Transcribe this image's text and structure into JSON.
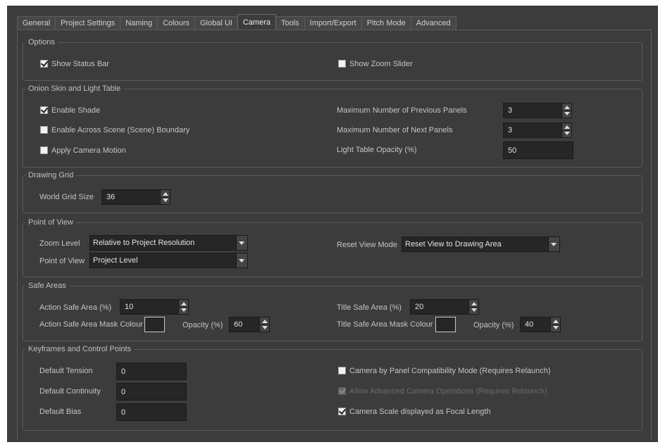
{
  "tabs": [
    {
      "label": "General",
      "active": false
    },
    {
      "label": "Project Settings",
      "active": false
    },
    {
      "label": "Naming",
      "active": false
    },
    {
      "label": "Colours",
      "active": false
    },
    {
      "label": "Global UI",
      "active": false
    },
    {
      "label": "Camera",
      "active": true
    },
    {
      "label": "Tools",
      "active": false
    },
    {
      "label": "Import/Export",
      "active": false
    },
    {
      "label": "Pitch Mode",
      "active": false
    },
    {
      "label": "Advanced",
      "active": false
    }
  ],
  "options": {
    "title": "Options",
    "show_status_bar": {
      "label": "Show Status Bar",
      "checked": true
    },
    "show_zoom_slider": {
      "label": "Show Zoom Slider",
      "checked": false
    }
  },
  "onion": {
    "title": "Onion Skin and Light Table",
    "enable_shade": {
      "label": "Enable Shade",
      "checked": true
    },
    "across_boundary": {
      "label": "Enable Across Scene (Scene) Boundary",
      "checked": false
    },
    "camera_motion": {
      "label": "Apply Camera Motion",
      "checked": false
    },
    "max_prev_label": "Maximum Number of Previous Panels",
    "max_prev_value": "3",
    "max_next_label": "Maximum Number of Next Panels",
    "max_next_value": "3",
    "opacity_label": "Light Table Opacity (%)",
    "opacity_value": "50"
  },
  "grid": {
    "title": "Drawing Grid",
    "size_label": "World Grid Size",
    "size_value": "36"
  },
  "pov": {
    "title": "Point of View",
    "zoom_label": "Zoom Level",
    "zoom_value": "Relative to Project Resolution",
    "pov_label": "Point of View",
    "pov_value": "Project Level",
    "reset_label": "Reset View Mode",
    "reset_value": "Reset View to Drawing Area"
  },
  "safe": {
    "title": "Safe Areas",
    "action_label": "Action Safe Area (%)",
    "action_value": "10",
    "action_mask_label": "Action Safe Area Mask Colour",
    "action_opacity_label": "Opacity (%)",
    "action_opacity_value": "60",
    "title_label": "Title Safe Area (%)",
    "title_value": "20",
    "title_mask_label": "Title Safe Area Mask Colour",
    "title_opacity_label": "Opacity (%)",
    "title_opacity_value": "40"
  },
  "keys": {
    "title": "Keyframes and Control Points",
    "tension_label": "Default Tension",
    "tension_value": "0",
    "continuity_label": "Default Continuity",
    "continuity_value": "0",
    "bias_label": "Default Bias",
    "bias_value": "0",
    "compat": {
      "label": "Camera by Panel Compatibility Mode (Requires Relaunch)",
      "checked": false
    },
    "advanced": {
      "label": "Allow Advanced Camera Operations (Requires Relaunch)",
      "checked": true,
      "disabled": true
    },
    "focal": {
      "label": "Camera Scale displayed as Focal Length",
      "checked": true
    }
  },
  "colors": {
    "window_bg": "#3c3c3c",
    "field_bg": "#262626",
    "text": "#c4c4c4",
    "disabled_text": "#6a6a6a"
  }
}
